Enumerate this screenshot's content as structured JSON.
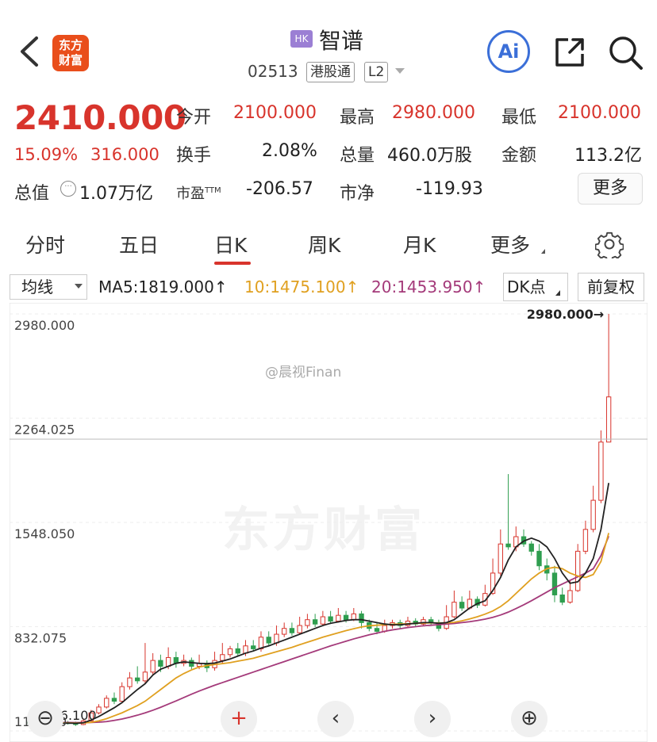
{
  "header": {
    "back_icon": "chevron-left-icon",
    "logo_text": "东方\n财富",
    "market_badge": "HK",
    "stock_name": "智谱",
    "stock_code": "02513",
    "connect_tag": "港股通",
    "level_tag": "L2",
    "ai_label": "Ai",
    "share_icon": "share-icon",
    "search_icon": "search-icon"
  },
  "quote": {
    "price": "2410.000",
    "change_pct": "15.09%",
    "change_abs": "316.000",
    "open_label": "今开",
    "open": "2100.000",
    "high_label": "最高",
    "high": "2980.000",
    "low_label": "最低",
    "low": "2100.000",
    "turnover_label": "换手",
    "turnover": "2.08%",
    "volume_label": "总量",
    "volume": "460.0万股",
    "amount_label": "金额",
    "amount": "113.2亿",
    "mcap_label": "总值",
    "mcap": "1.07万亿",
    "pe_label": "市盈",
    "pe_sup": "TTM",
    "pe": "-206.57",
    "pb_label": "市净",
    "pb": "-119.93",
    "more_button": "更多"
  },
  "tabs": [
    {
      "label": "分时"
    },
    {
      "label": "五日"
    },
    {
      "label": "日K",
      "active": true
    },
    {
      "label": "周K"
    },
    {
      "label": "月K"
    },
    {
      "label": "更多"
    }
  ],
  "indicators": {
    "ma_select": "均线",
    "ma5": "MA5:1819.000↑",
    "ma10": "10:1475.100↑",
    "ma20": "20:1453.950↑",
    "dk_button": "DK点",
    "adjust_button": "前复权",
    "ma5_color": "#222222",
    "ma10_color": "#e0a020",
    "ma20_color": "#a43a7a"
  },
  "watermark": "@晨视Finan",
  "background_logo": "东方财富",
  "chart_data": {
    "type": "candlestick",
    "y_ticks": [
      "2980.000",
      "2264.025",
      "1548.050",
      "832.075",
      "116.100"
    ],
    "ylim": [
      116.1,
      2980.0
    ],
    "max_marker": "2980.000→",
    "min_marker": "116.100",
    "up_color": "#d8342c",
    "down_color": "#2f9e4f",
    "candles": [
      [
        180,
        170,
        200,
        160
      ],
      [
        170,
        175,
        190,
        160
      ],
      [
        175,
        160,
        185,
        150
      ],
      [
        160,
        165,
        180,
        150
      ],
      [
        165,
        175,
        185,
        155
      ],
      [
        175,
        170,
        185,
        160
      ],
      [
        170,
        160,
        180,
        150
      ],
      [
        160,
        185,
        200,
        155
      ],
      [
        185,
        240,
        260,
        180
      ],
      [
        240,
        280,
        300,
        230
      ],
      [
        280,
        340,
        360,
        270
      ],
      [
        340,
        320,
        380,
        300
      ],
      [
        320,
        420,
        450,
        310
      ],
      [
        420,
        480,
        520,
        400
      ],
      [
        480,
        460,
        560,
        440
      ],
      [
        460,
        520,
        720,
        440
      ],
      [
        520,
        600,
        650,
        500
      ],
      [
        600,
        560,
        640,
        520
      ],
      [
        560,
        620,
        690,
        540
      ],
      [
        620,
        580,
        660,
        550
      ],
      [
        580,
        600,
        640,
        560
      ],
      [
        600,
        560,
        620,
        540
      ],
      [
        560,
        580,
        640,
        540
      ],
      [
        580,
        550,
        600,
        520
      ],
      [
        550,
        600,
        660,
        530
      ],
      [
        600,
        640,
        720,
        580
      ],
      [
        640,
        680,
        700,
        620
      ],
      [
        680,
        650,
        720,
        630
      ],
      [
        650,
        700,
        740,
        630
      ],
      [
        700,
        680,
        740,
        660
      ],
      [
        680,
        760,
        800,
        660
      ],
      [
        760,
        720,
        800,
        700
      ],
      [
        720,
        780,
        840,
        700
      ],
      [
        780,
        820,
        860,
        760
      ],
      [
        820,
        790,
        860,
        770
      ],
      [
        790,
        840,
        900,
        780
      ],
      [
        840,
        880,
        920,
        820
      ],
      [
        880,
        850,
        920,
        830
      ],
      [
        850,
        900,
        940,
        840
      ],
      [
        900,
        870,
        940,
        850
      ],
      [
        870,
        910,
        960,
        860
      ],
      [
        910,
        880,
        940,
        860
      ],
      [
        880,
        920,
        960,
        870
      ],
      [
        920,
        860,
        940,
        820
      ],
      [
        860,
        820,
        880,
        800
      ],
      [
        820,
        800,
        860,
        780
      ],
      [
        800,
        840,
        880,
        790
      ],
      [
        840,
        860,
        880,
        820
      ],
      [
        860,
        840,
        880,
        820
      ],
      [
        840,
        870,
        900,
        830
      ],
      [
        870,
        850,
        890,
        830
      ],
      [
        850,
        880,
        900,
        840
      ],
      [
        880,
        860,
        900,
        840
      ],
      [
        860,
        820,
        880,
        800
      ],
      [
        820,
        900,
        980,
        810
      ],
      [
        900,
        1000,
        1080,
        890
      ],
      [
        1000,
        960,
        1040,
        940
      ],
      [
        960,
        1020,
        1080,
        950
      ],
      [
        1020,
        980,
        1040,
        960
      ],
      [
        980,
        1060,
        1120,
        970
      ],
      [
        1060,
        1200,
        1300,
        1050
      ],
      [
        1200,
        1400,
        1500,
        1180
      ],
      [
        1400,
        1380,
        1880,
        1360
      ],
      [
        1380,
        1450,
        1520,
        1350
      ],
      [
        1450,
        1400,
        1500,
        1380
      ],
      [
        1400,
        1350,
        1420,
        1320
      ],
      [
        1350,
        1250,
        1400,
        1220
      ],
      [
        1250,
        1200,
        1300,
        1150
      ],
      [
        1200,
        1050,
        1250,
        1000
      ],
      [
        1050,
        1000,
        1100,
        980
      ],
      [
        1000,
        1080,
        1150,
        990
      ],
      [
        1080,
        1350,
        1400,
        1070
      ],
      [
        1350,
        1500,
        1560,
        1330
      ],
      [
        1500,
        1700,
        1800,
        1480
      ],
      [
        1700,
        2100,
        2180,
        1680
      ],
      [
        2100,
        2410,
        2980,
        2100
      ]
    ],
    "ma5": [
      175,
      172,
      170,
      168,
      167,
      170,
      168,
      172,
      190,
      215,
      245,
      275,
      310,
      355,
      400,
      440,
      500,
      540,
      560,
      580,
      590,
      585,
      580,
      578,
      582,
      595,
      610,
      630,
      650,
      665,
      685,
      700,
      720,
      740,
      760,
      780,
      800,
      820,
      840,
      855,
      865,
      875,
      880,
      880,
      870,
      860,
      850,
      845,
      845,
      850,
      855,
      860,
      860,
      855,
      860,
      880,
      920,
      960,
      990,
      1010,
      1080,
      1170,
      1290,
      1380,
      1420,
      1440,
      1420,
      1380,
      1300,
      1200,
      1130,
      1140,
      1200,
      1300,
      1500,
      1819
    ],
    "ma10": [
      175,
      174,
      173,
      172,
      171,
      171,
      170,
      171,
      175,
      185,
      200,
      220,
      240,
      265,
      290,
      320,
      360,
      400,
      440,
      480,
      510,
      535,
      555,
      565,
      572,
      578,
      585,
      595,
      605,
      615,
      630,
      645,
      660,
      675,
      690,
      708,
      725,
      742,
      760,
      775,
      790,
      805,
      818,
      830,
      838,
      842,
      846,
      848,
      850,
      852,
      855,
      857,
      858,
      858,
      858,
      862,
      872,
      885,
      900,
      918,
      940,
      970,
      1010,
      1060,
      1110,
      1160,
      1200,
      1230,
      1240,
      1230,
      1200,
      1180,
      1170,
      1190,
      1280,
      1475.1
    ],
    "ma20": [
      176,
      176,
      175,
      175,
      174,
      174,
      173,
      173,
      174,
      176,
      180,
      188,
      198,
      210,
      224,
      240,
      258,
      278,
      300,
      322,
      345,
      368,
      390,
      410,
      430,
      448,
      466,
      484,
      502,
      520,
      538,
      556,
      574,
      592,
      610,
      628,
      646,
      664,
      682,
      700,
      716,
      732,
      748,
      762,
      776,
      788,
      800,
      810,
      818,
      826,
      832,
      838,
      842,
      846,
      850,
      854,
      860,
      866,
      874,
      884,
      896,
      912,
      932,
      956,
      982,
      1010,
      1040,
      1070,
      1100,
      1125,
      1150,
      1175,
      1200,
      1230,
      1320,
      1453.95
    ]
  },
  "controls": {
    "prev_icon": "chevron-left-icon",
    "next_icon": "chevron-right-icon",
    "add_icon": "plus-icon",
    "zoom_out_icon": "zoom-out-icon",
    "zoom_in_icon": "zoom-in-icon"
  }
}
